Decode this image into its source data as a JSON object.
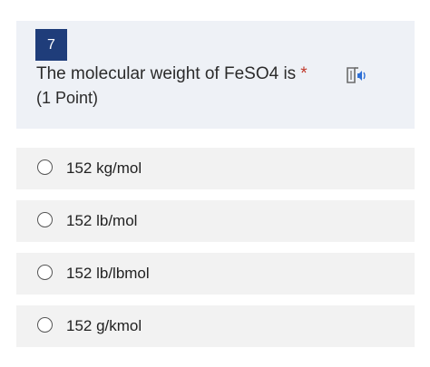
{
  "question": {
    "number": "7",
    "text": "The molecular weight of FeSO4 is",
    "required_marker": "*",
    "points": "(1 Point)",
    "reader_icon": "immersive-reader-icon"
  },
  "options": [
    {
      "label": "152 kg/mol",
      "selected": false
    },
    {
      "label": "152 lb/mol",
      "selected": false
    },
    {
      "label": "152 lb/lbmol",
      "selected": false
    },
    {
      "label": "152 g/kmol",
      "selected": false
    }
  ],
  "colors": {
    "badge": "#1f3d7a",
    "card_background": "#eef1f6",
    "option_background": "#f2f2f2",
    "required": "#c0392b",
    "icon_accent": "#2e6fd6"
  }
}
